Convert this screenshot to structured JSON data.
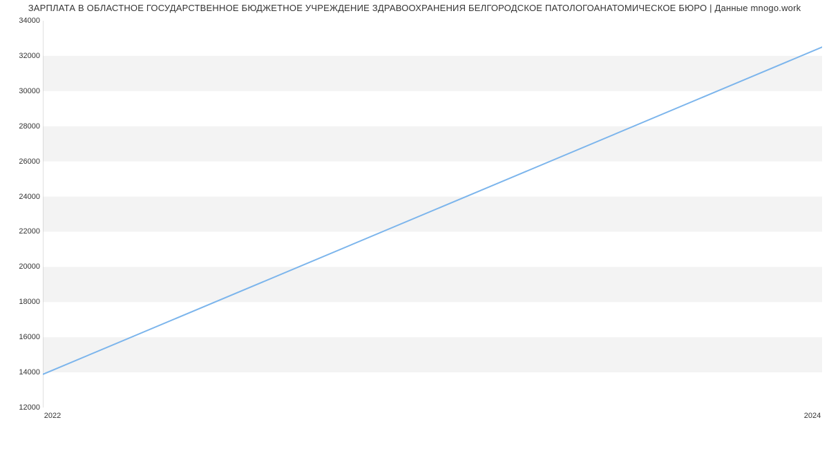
{
  "chart_data": {
    "type": "line",
    "title": "ЗАРПЛАТА В ОБЛАСТНОЕ ГОСУДАРСТВЕННОЕ БЮДЖЕТНОЕ УЧРЕЖДЕНИЕ ЗДРАВООХРАНЕНИЯ БЕЛГОРОДСКОЕ ПАТОЛОГОАНАТОМИЧЕСКОЕ БЮРО | Данные mnogo.work",
    "xlabel": "",
    "ylabel": "",
    "x": [
      2022,
      2024
    ],
    "values": [
      13890,
      32500
    ],
    "x_ticks": [
      2022,
      2024
    ],
    "y_ticks": [
      12000,
      14000,
      16000,
      18000,
      20000,
      22000,
      24000,
      26000,
      28000,
      30000,
      32000,
      34000
    ],
    "xlim": [
      2022,
      2024
    ],
    "ylim": [
      12000,
      34000
    ],
    "line_color": "#7cb5ec",
    "grid_band_color": "#f3f3f3"
  }
}
